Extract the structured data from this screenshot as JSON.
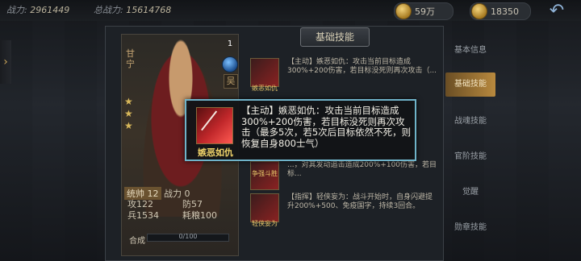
{
  "header": {
    "combat_label": "战力:",
    "combat_value": "2961449",
    "total_label": "总战力:",
    "total_value": "15614768",
    "currency1": "59万",
    "currency2": "18350"
  },
  "panel_title": "基础技能",
  "hero": {
    "name": "甘宁",
    "level": "1",
    "faction": "吴",
    "stars": 3,
    "lead_label": "统帅",
    "lead_value": "12",
    "fight_label": "战力",
    "fight_value": "0",
    "attack": "攻122",
    "defense": "防57",
    "troops": "兵1534",
    "food": "耗粮100",
    "compose_label": "合成",
    "compose_progress": "0/100",
    "compose_fraction": 0
  },
  "skills": [
    {
      "icon_name": "嫉恶如仇",
      "desc": "【主动】嫉恶如仇：攻击当前目标造成300%+200伤害，若目标没死则再次攻击（..."
    },
    {
      "icon_name": "争强斗胜",
      "desc": "...，对其发动追击造成200%+100伤害，若目标..."
    },
    {
      "icon_name": "轻侠妄为",
      "desc": "【指挥】轻侠妄为：战斗开始时，自身闪避提升200%+500、免疫国字，持续3回合。"
    }
  ],
  "sidebar": [
    "基本信息",
    "基础技能",
    "战魂技能",
    "官阶技能",
    "觉醒",
    "勋章技能"
  ],
  "sidebar_active_index": 1,
  "tooltip": {
    "icon_name": "嫉恶如仇",
    "text": "【主动】嫉恶如仇：攻击当前目标造成300%+200伤害，若目标没死则再次攻击（最多5次，若5次后目标依然不死，则恢复自身800士气）"
  },
  "colors": {
    "accent_gold": "#b8893e",
    "tooltip_border": "#6fb3c9"
  }
}
